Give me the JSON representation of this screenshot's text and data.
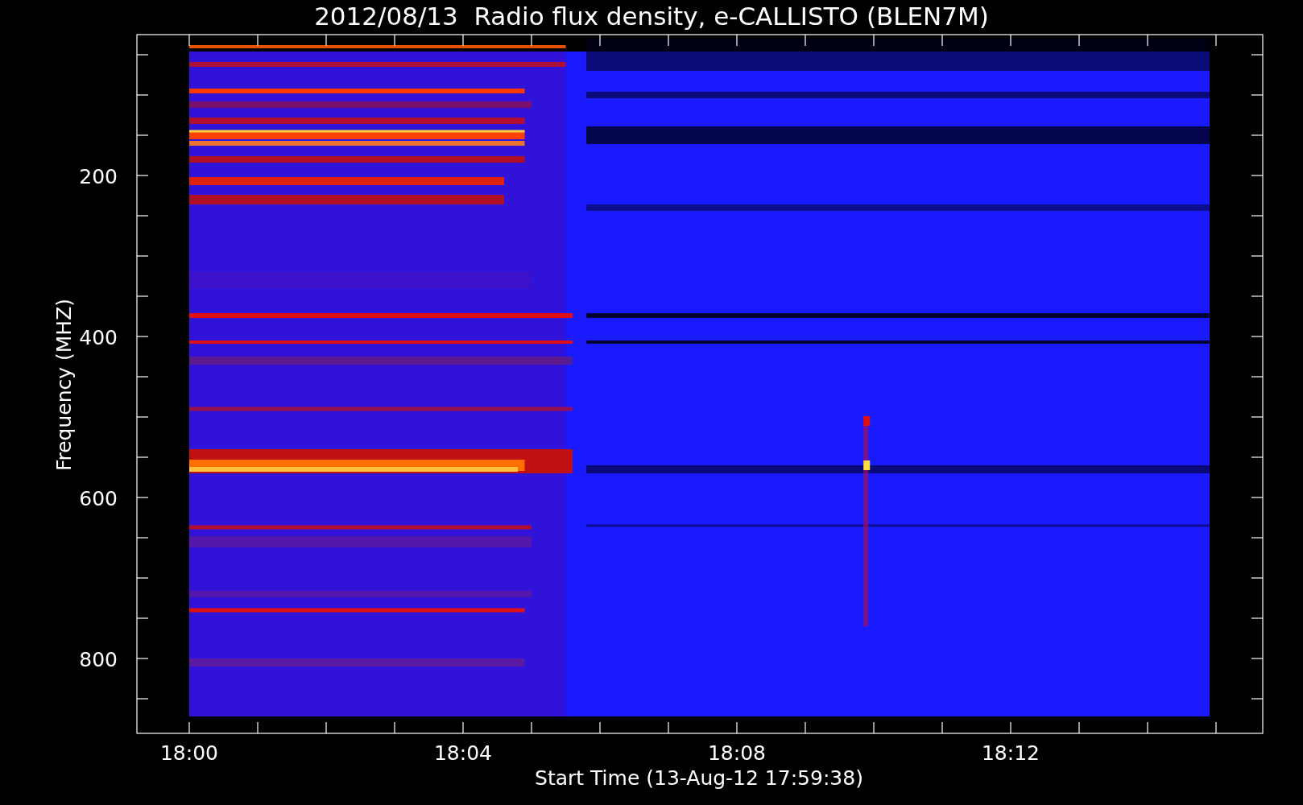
{
  "plot": {
    "title": "2012/08/13  Radio flux density, e-CALLISTO (BLEN7M)",
    "ylabel": "Frequency (MHZ)",
    "xlabel": "Start Time (13-Aug-12 17:59:38)",
    "yticks": [
      "200",
      "400",
      "600",
      "800"
    ],
    "xticks": [
      "18:00",
      "18:04",
      "18:08",
      "18:12"
    ]
  }
}
